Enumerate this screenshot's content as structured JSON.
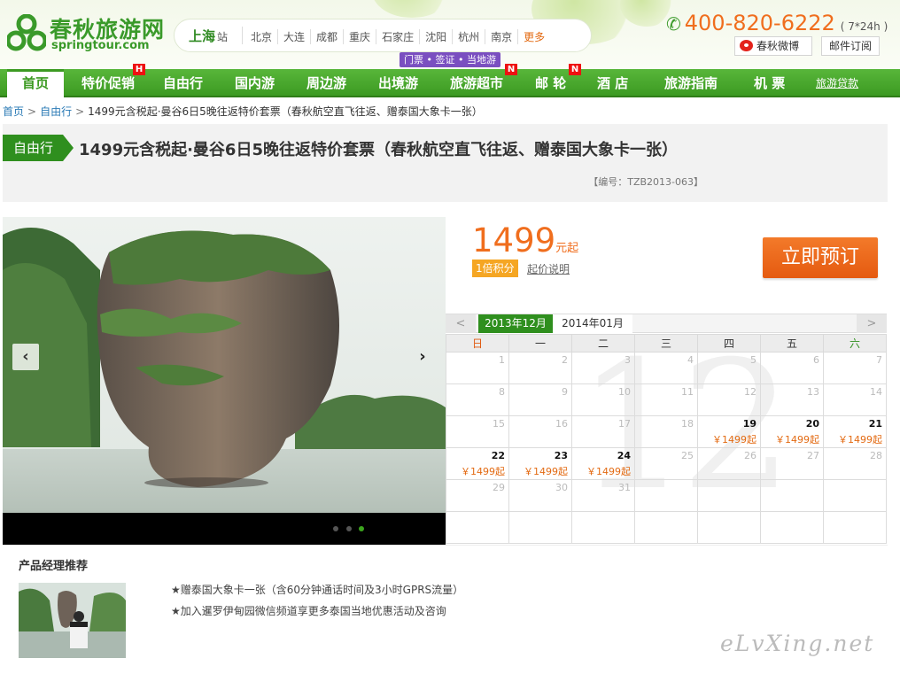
{
  "header": {
    "logo_cn": "春秋旅游网",
    "logo_en": "springtour.com",
    "current_city": "上海",
    "city_suffix": "站",
    "cities": [
      "北京",
      "大连",
      "成都",
      "重庆",
      "石家庄",
      "沈阳",
      "杭州",
      "南京"
    ],
    "more_label": "更多",
    "promo_label": "门票 • 签证 • 当地游",
    "phone": "400-820-6222",
    "phone_hours": "( 7*24h )",
    "weibo_label": "春秋微博",
    "mail_label": "邮件订阅"
  },
  "nav": {
    "items": [
      "首页",
      "特价促销",
      "自由行",
      "国内游",
      "周边游",
      "出境游",
      "旅游超市",
      "邮 轮",
      "酒 店",
      "旅游指南",
      "机 票",
      "旅游贷款"
    ],
    "badges": {
      "hot": "H",
      "new": "N"
    }
  },
  "breadcrumb": {
    "home": "首页",
    "category": "自由行",
    "current": "1499元含税起·曼谷6日5晚往返特价套票（春秋航空直飞往返、赠泰国大象卡一张）",
    "separator": ">"
  },
  "product": {
    "tag": "自由行",
    "title": "1499元含税起·曼谷6日5晚往返特价套票（春秋航空直飞往返、赠泰国大象卡一张）",
    "code": "【编号：TZB2013-063】",
    "price": "1499",
    "price_unit": "元起",
    "points": "1倍积分",
    "price_explain": "起价说明",
    "book_label": "立即预订"
  },
  "slider": {
    "prev": "‹",
    "next": "›",
    "dots": 3,
    "active_dot": 2
  },
  "calendar": {
    "prev": "<",
    "next": ">",
    "month_active": "2013年12月",
    "month_next": "2014年01月",
    "big_number": "12",
    "weekdays": [
      "日",
      "一",
      "二",
      "三",
      "四",
      "五",
      "六"
    ],
    "weeks": [
      [
        {
          "d": "1"
        },
        {
          "d": "2"
        },
        {
          "d": "3"
        },
        {
          "d": "4"
        },
        {
          "d": "5"
        },
        {
          "d": "6"
        },
        {
          "d": "7"
        }
      ],
      [
        {
          "d": "8"
        },
        {
          "d": "9"
        },
        {
          "d": "10"
        },
        {
          "d": "11"
        },
        {
          "d": "12"
        },
        {
          "d": "13"
        },
        {
          "d": "14"
        }
      ],
      [
        {
          "d": "15"
        },
        {
          "d": "16"
        },
        {
          "d": "17"
        },
        {
          "d": "18"
        },
        {
          "d": "19",
          "p": "￥1499起"
        },
        {
          "d": "20",
          "p": "￥1499起"
        },
        {
          "d": "21",
          "p": "￥1499起"
        }
      ],
      [
        {
          "d": "22",
          "p": "￥1499起"
        },
        {
          "d": "23",
          "p": "￥1499起"
        },
        {
          "d": "24",
          "p": "￥1499起"
        },
        {
          "d": "25"
        },
        {
          "d": "26"
        },
        {
          "d": "27"
        },
        {
          "d": "28"
        }
      ],
      [
        {
          "d": "29"
        },
        {
          "d": "30"
        },
        {
          "d": "31"
        },
        {
          "d": ""
        },
        {
          "d": ""
        },
        {
          "d": ""
        },
        {
          "d": ""
        }
      ],
      [
        {
          "d": ""
        },
        {
          "d": ""
        },
        {
          "d": ""
        },
        {
          "d": ""
        },
        {
          "d": ""
        },
        {
          "d": ""
        },
        {
          "d": ""
        }
      ]
    ]
  },
  "recommend": {
    "title": "产品经理推荐",
    "lines": [
      "★赠泰国大象卡一张（含60分钟通话时间及3小时GPRS流量）",
      "★加入暹罗伊甸园微信频道享更多泰国当地优惠活动及咨询"
    ]
  },
  "watermark": "eLvXing.net",
  "colors": {
    "brand_green": "#3c9a22",
    "accent_orange": "#f06e1e"
  }
}
